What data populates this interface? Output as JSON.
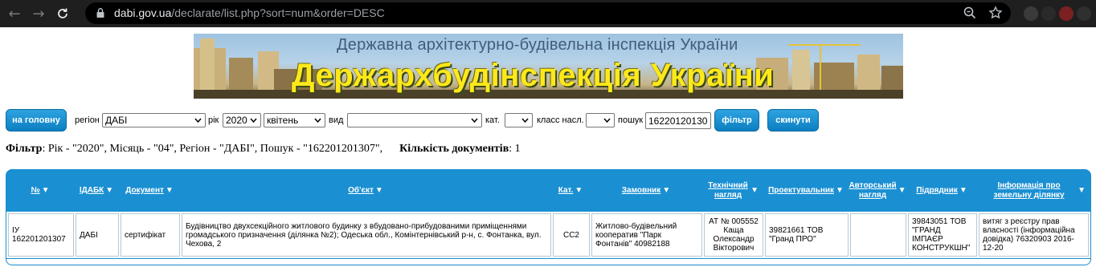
{
  "browser": {
    "url_domain": "dabi.gov.ua",
    "url_path": "/declarate/list.php?sort=num&order=DESC"
  },
  "banner": {
    "subtitle": "Державна архітектурно-будівельна інспекція України",
    "title": "Держархбудінспекція України"
  },
  "filters": {
    "home_button": "на головну",
    "region_label": "регіон",
    "region_value": "ДАБІ",
    "year_label": "рік",
    "year_value": "2020",
    "month_value": "квітень",
    "type_label": "вид",
    "type_value": "",
    "category_label": "кат.",
    "category_value": "",
    "class_label": "класс насл.",
    "class_value": "",
    "search_label": "пошук",
    "search_value": "16220120130",
    "filter_button": "фільтр",
    "reset_button": "скинути"
  },
  "summary": {
    "filter_label": "Фільтр",
    "filter_text": ": Рік - \"2020\", Місяць - \"04\", Регіон - \"ДАБІ\", Пошук - \"162201201307\",",
    "count_label": "Кількість документів",
    "count_value": ": 1"
  },
  "table": {
    "headers": [
      {
        "label": "№",
        "arrow": "▼"
      },
      {
        "label": "ІДАБК",
        "arrow": "▼"
      },
      {
        "label": "Документ",
        "arrow": "▼"
      },
      {
        "label": "Об'єкт",
        "arrow": "▼"
      },
      {
        "label": "Кат.",
        "arrow": "▼"
      },
      {
        "label": "Замовник",
        "arrow": "▼"
      },
      {
        "label": "Технічний нагляд",
        "arrow": "▼"
      },
      {
        "label": "Проектувальник",
        "arrow": "▼"
      },
      {
        "label": "Авторський нагляд",
        "arrow": "▼"
      },
      {
        "label": "Підрядник",
        "arrow": "▼"
      },
      {
        "label": "Інформація про земельну ділянку",
        "arrow": "▼"
      }
    ],
    "row": {
      "num": "ІУ 162201201307",
      "idabk": "ДАБІ",
      "document": "сертифікат",
      "object": "Будівництво двухсекційного житлового будинку з вбудовано-прибудованими приміщеннями громадського призначення (ділянка №2); Одеська обл., Комінтернівський р-н, с. Фонтанка, вул. Чехова, 2",
      "category": "СС2",
      "customer": "Житлово-будівельний кооператив \"Парк Фонтанів\" 40982188",
      "tech_supervision": "АТ № 005552 Каща Олександр Вікторович",
      "designer": "39821661 ТОВ \"Гранд ПРО\"",
      "author_supervision": "",
      "contractor": "39843051 ТОВ \"ГРАНД ІМПАЄР КОНСТРУКШН\"",
      "land_info": "витяг з реєстру прав власності (інформаційна довідка) 76320903 2016-12-20"
    }
  },
  "colors": {
    "accent": "#1a8fd2",
    "button": "#0c7fc2",
    "banner_title": "#ffe81a",
    "chrome_bg": "#1f1f1f"
  }
}
